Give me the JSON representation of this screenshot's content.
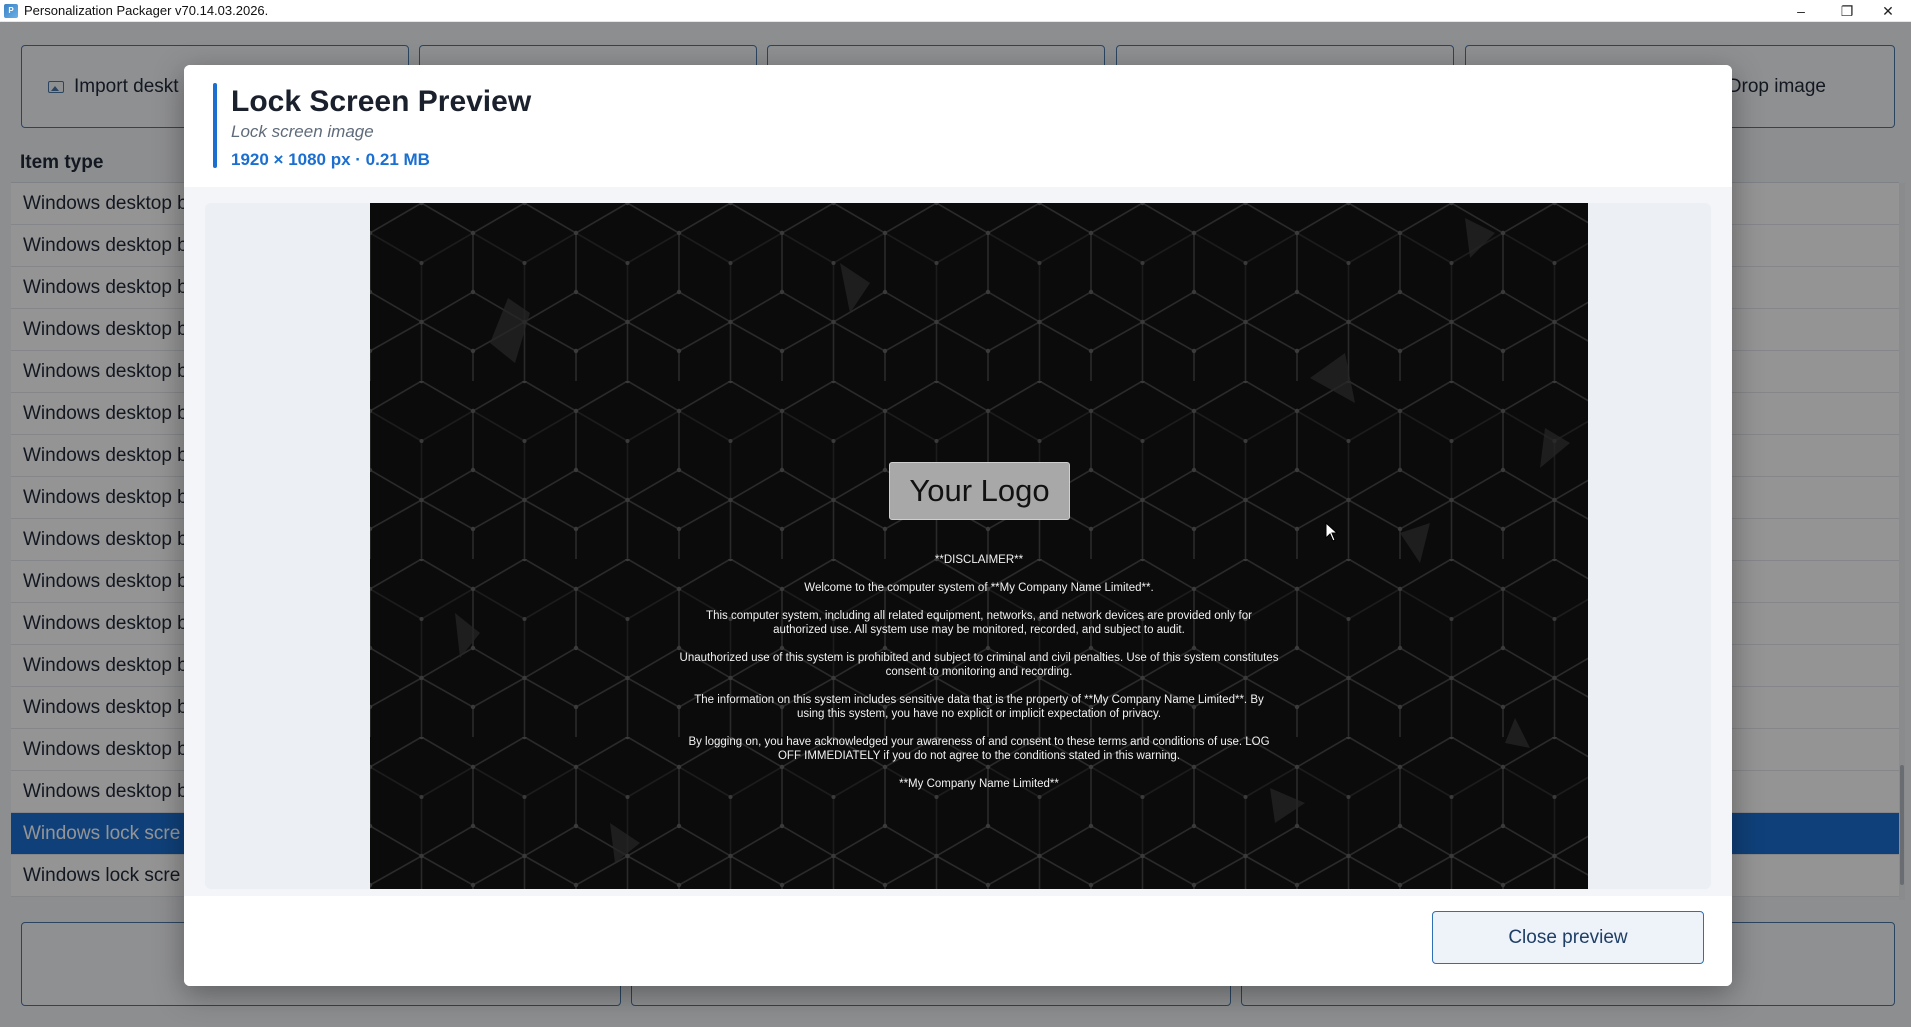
{
  "window": {
    "title": "Personalization Packager v70.14.03.2026.",
    "minimize_glyph": "–",
    "maximize_glyph": "❐",
    "close_glyph": "✕"
  },
  "background": {
    "top_buttons": [
      {
        "label": "Import deskt",
        "icon": "image-icon"
      },
      {
        "label": ""
      },
      {
        "label": ""
      },
      {
        "label": ""
      },
      {
        "label": "Drop image"
      }
    ],
    "column_header": "Item type",
    "list_items": [
      "Windows desktop b",
      "Windows desktop b",
      "Windows desktop b",
      "Windows desktop b",
      "Windows desktop b",
      "Windows desktop b",
      "Windows desktop b",
      "Windows desktop b",
      "Windows desktop b",
      "Windows desktop b",
      "Windows desktop b",
      "Windows desktop b",
      "Windows desktop b",
      "Windows desktop b",
      "Windows desktop b",
      "Windows lock scre",
      "Windows lock scre"
    ],
    "selected_index": 15
  },
  "modal": {
    "title": "Lock Screen Preview",
    "subtitle": "Lock screen image",
    "meta": "1920 × 1080 px · 0.21 MB",
    "preview": {
      "logo_text": "Your Logo",
      "disclaimer": [
        "**DISCLAIMER**",
        "Welcome to the computer system of **My Company Name Limited**.",
        "This computer system, including all related equipment, networks, and network devices are provided only for authorized use. All system use may be monitored, recorded, and subject to audit.",
        "Unauthorized use of this system is prohibited and subject to criminal and civil penalties. Use of this system constitutes consent to monitoring and recording.",
        "The information on this system includes sensitive data that is the property of **My Company Name Limited**. By using this system, you have no explicit or implicit expectation of privacy.",
        "By logging on, you have acknowledged your awareness of and consent to these terms and conditions of use. LOG OFF IMMEDIATELY if you do not agree to the conditions stated in this warning.",
        "**My Company Name Limited**"
      ]
    },
    "close_label": "Close preview"
  },
  "colors": {
    "accent": "#1b6fd1",
    "selected_row": "#1b6fd1",
    "preview_bg": "#0b0b0b",
    "button_border": "#2f6fb5"
  }
}
